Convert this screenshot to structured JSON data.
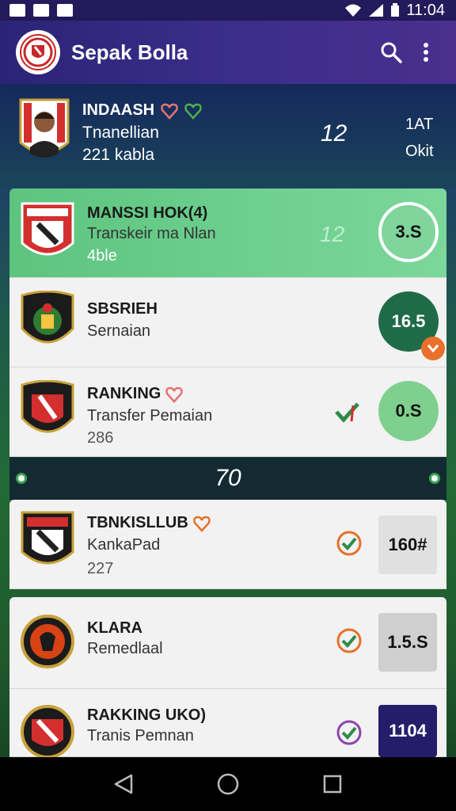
{
  "status_bar": {
    "time": "11:04"
  },
  "app_bar": {
    "title": "Sepak Bolla"
  },
  "hero": {
    "name": "INDAASH",
    "subtitle": "Tnanellian",
    "meta": "221 kabla",
    "number": "12",
    "right_top": "1AT",
    "right_bottom": "Okit"
  },
  "cards": [
    {
      "title": "MANSSI HOK(4)",
      "subtitle": "Transkeir ma Nlan",
      "meta": "4ble",
      "center": "12",
      "score": "3.S"
    },
    {
      "title": "SBSRIEH",
      "subtitle": "Sernaian",
      "score": "16.5"
    },
    {
      "title": "RANKING",
      "subtitle": "Transfer Pemaian",
      "meta": "286",
      "score": "0.S"
    },
    {
      "title": "TBNKISLLUB",
      "subtitle": "KankaPad",
      "meta": "227",
      "score": "160#"
    },
    {
      "title": "KLARA",
      "subtitle": "Remedlaal",
      "score": "1.5.S"
    },
    {
      "title": "RAKKING UKO)",
      "subtitle": "Tranis Pemnan",
      "score": "1104"
    }
  ],
  "divider": {
    "text": "70"
  },
  "colors": {
    "accent_green": "#5dc47e",
    "dark_green": "#1f6b48",
    "navy": "#241e6a",
    "orange": "#e8702a"
  }
}
